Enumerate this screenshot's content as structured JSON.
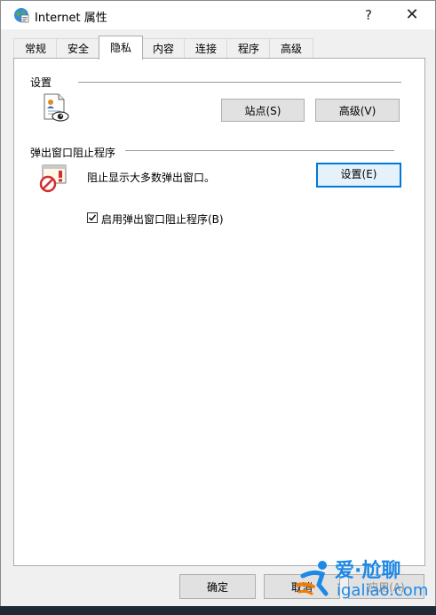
{
  "window": {
    "title": "Internet 属性",
    "help_label": "?",
    "close_label": "✕"
  },
  "tabs": [
    {
      "label": "常规",
      "active": false
    },
    {
      "label": "安全",
      "active": false
    },
    {
      "label": "隐私",
      "active": true
    },
    {
      "label": "内容",
      "active": false
    },
    {
      "label": "连接",
      "active": false
    },
    {
      "label": "程序",
      "active": false
    },
    {
      "label": "高级",
      "active": false
    }
  ],
  "settings_group": {
    "title": "设置",
    "sites_button": "站点(S)",
    "advanced_button": "高级(V)",
    "icon": "privacy-document-eye-icon"
  },
  "popup_group": {
    "title": "弹出窗口阻止程序",
    "description": "阻止显示大多数弹出窗口。",
    "settings_button": "设置(E)",
    "icon": "popup-blocked-icon",
    "checkbox_label": "启用弹出窗口阻止程序(B)",
    "checkbox_checked": true
  },
  "footer": {
    "ok_label": "确定",
    "cancel_label": "取消",
    "apply_label": "应用(A)"
  },
  "watermark": {
    "brand": "爱·尬聊",
    "url": "igaliao.com"
  },
  "colors": {
    "focus_border": "#0078d7",
    "watermark_blue": "#1e88e5",
    "watermark_orange": "#f57c00"
  }
}
